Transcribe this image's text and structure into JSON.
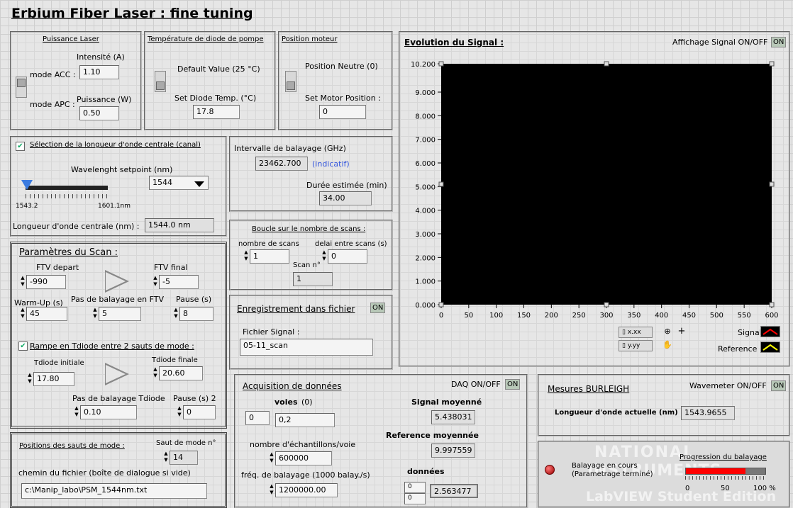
{
  "title": "Erbium Fiber Laser : fine tuning",
  "puissance": {
    "legend": "Puissance Laser",
    "intensite_label": "Intensité (A)",
    "mode_acc": "mode ACC :",
    "mode_apc": "mode APC :",
    "intensite_value": "1.10",
    "puissance_label": "Puissance (W)",
    "puissance_value": "0.50"
  },
  "temperature": {
    "legend": "Température de diode de pompe",
    "default_label": "Default Value (25 °C)",
    "set_label": "Set Diode Temp. (°C)",
    "set_value": "17.8"
  },
  "moteur": {
    "legend": "Position moteur",
    "neutre_label": "Position Neutre (0)",
    "set_label": "Set Motor Position :",
    "set_value": "0"
  },
  "selection": {
    "checkbox_label": "Sélection de la longueur d'onde centrale (canal)",
    "wavelength_label": "Wavelenght setpoint (nm)",
    "select_value": "1544",
    "slider_min": "1543.2",
    "slider_max": "1601.1nm",
    "central_label": "Longueur d'onde centrale (nm) :",
    "central_value": "1544.0 nm"
  },
  "intervalle": {
    "label": "Intervalle de balayage (GHz)",
    "value": "23462.700",
    "indicatif": "(indicatif)",
    "duree_label": "Durée estimée (min)",
    "duree_value": "34.00"
  },
  "boucle": {
    "legend": "Boucle sur le nombre de scans :",
    "nb_label": "nombre de scans",
    "nb_value": "1",
    "delai_label": "delai entre scans (s)",
    "delai_value": "0",
    "scan_label": "Scan n°",
    "scan_value": "1"
  },
  "scan": {
    "title": "Paramètres du Scan :",
    "ftv_depart_label": "FTV depart",
    "ftv_depart_value": "-990",
    "ftv_final_label": "FTV final",
    "ftv_final_value": "-5",
    "warmup_label": "Warm-Up (s)",
    "warmup_value": "45",
    "pas_ftv_label": "Pas de balayage en FTV",
    "pas_ftv_value": "5",
    "pause_label": "Pause (s)",
    "pause_value": "8",
    "rampe_label": "Rampe en Tdiode entre 2 sauts de mode :",
    "tdiode_init_label": "Tdiode initiale",
    "tdiode_init_value": "17.80",
    "tdiode_final_label": "Tdiode finale",
    "tdiode_final_value": "20.60",
    "pas_tdiode_label": "Pas de balayage Tdiode",
    "pas_tdiode_value": "0.10",
    "pause2_label": "Pause (s) 2",
    "pause2_value": "0"
  },
  "enregistrement": {
    "title": "Enregistrement dans fichier",
    "on": "ON",
    "fichier_label": "Fichier Signal :",
    "fichier_value": "05-11_scan"
  },
  "sauts": {
    "legend": "Positions des sauts de mode :",
    "saut_label": "Saut de mode n°",
    "saut_value": "14",
    "chemin_label": "chemin du fichier (boîte de dialogue si vide)",
    "chemin_value": "c:\\Manip_labo\\PSM_1544nm.txt"
  },
  "acquisition": {
    "title": "Acquisition de données",
    "daq_label": "DAQ ON/OFF",
    "daq_on": "ON",
    "voies_label": "voies",
    "voies_suffix": "(0)",
    "voies_index": "0",
    "voies_value": "0,2",
    "signal_moy_label": "Signal moyenné",
    "signal_moy_value": "5.438031",
    "ref_moy_label": "Reference moyennée",
    "ref_moy_value": "9.997559",
    "nb_ech_label": "nombre d'échantillons/voie",
    "nb_ech_value": "600000",
    "freq_label": "fréq. de balayage (1000 balay./s)",
    "freq_value": "1200000.00",
    "donnees_label": "données",
    "donnees_idx1": "0",
    "donnees_idx2": "0",
    "donnees_value": "2.563477"
  },
  "chart": {
    "title": "Evolution du Signal :",
    "toggle_label": "Affichage Signal ON/OFF",
    "toggle_on": "ON",
    "legend_signal": "Signal",
    "legend_reference": "Reference",
    "tool_scale_x": "x.xx",
    "tool_scale_y": "y.yy"
  },
  "chart_data": {
    "type": "line",
    "title": "Evolution du Signal :",
    "xlim": [
      0,
      600
    ],
    "ylim": [
      0,
      10.2
    ],
    "xticks": [
      "0",
      "50",
      "100",
      "150",
      "200",
      "250",
      "300",
      "350",
      "400",
      "450",
      "500",
      "550",
      "600"
    ],
    "yticks": [
      "0.000",
      "1.000",
      "2.000",
      "3.000",
      "4.000",
      "5.000",
      "6.000",
      "7.000",
      "8.000",
      "9.000",
      "10.200"
    ],
    "series": [
      {
        "name": "Signal",
        "values": []
      },
      {
        "name": "Reference",
        "values": []
      }
    ],
    "grid": false,
    "legend": "bottom-right",
    "colors": {
      "signal": "#ff0000",
      "reference": "#ffff00",
      "background": "#000000"
    }
  },
  "burleigh": {
    "title": "Mesures BURLEIGH",
    "wavemeter_label": "Wavemeter ON/OFF",
    "wavemeter_on": "ON",
    "longueur_label": "Longueur d'onde actuelle (nm)",
    "longueur_value": "1543.9655"
  },
  "progression": {
    "label": "Progression du balayage",
    "balayage_line1": "Balayage en cours",
    "balayage_line2": "(Parametrage terminé)",
    "progress_percent": 75,
    "ticks": [
      "0",
      "50",
      "100 %"
    ]
  },
  "watermark": {
    "line1": "NATIONAL",
    "line2": "INSTRUMENTS",
    "line3": "LabVIEW Student Edition"
  }
}
